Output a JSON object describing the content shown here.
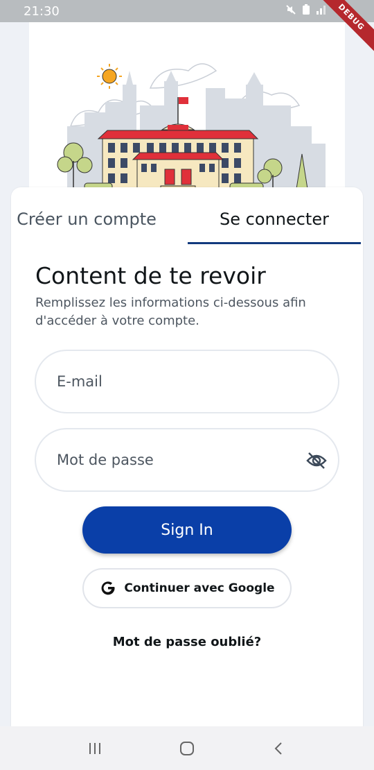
{
  "status_bar": {
    "time": "21:30",
    "icons": [
      "mute-icon",
      "battery-saver-icon",
      "signal-icon",
      "battery-icon"
    ],
    "debug_label": "DEBUG"
  },
  "hero": {
    "illustration": "university-building-illustration"
  },
  "tabs": [
    {
      "label": "Créer un compte",
      "active": false
    },
    {
      "label": "Se connecter",
      "active": true
    }
  ],
  "login": {
    "heading": "Content de te revoir",
    "subtitle": "Remplissez les informations ci-dessous afin d'accéder à votre compte.",
    "email": {
      "placeholder": "E-mail",
      "value": ""
    },
    "password": {
      "placeholder": "Mot de passe",
      "value": "",
      "visibility_icon": "eye-off-icon"
    },
    "sign_in_label": "Sign In",
    "google_label": "Continuer avec Google",
    "forgot_label": "Mot de passe oublié?"
  },
  "nav_bar": {
    "buttons": [
      "recents-icon",
      "home-icon",
      "back-icon"
    ]
  },
  "colors": {
    "primary": "#0a3fa8",
    "tab_indicator": "#123a7e",
    "background": "#eef1f6",
    "debug": "#b5282d"
  }
}
